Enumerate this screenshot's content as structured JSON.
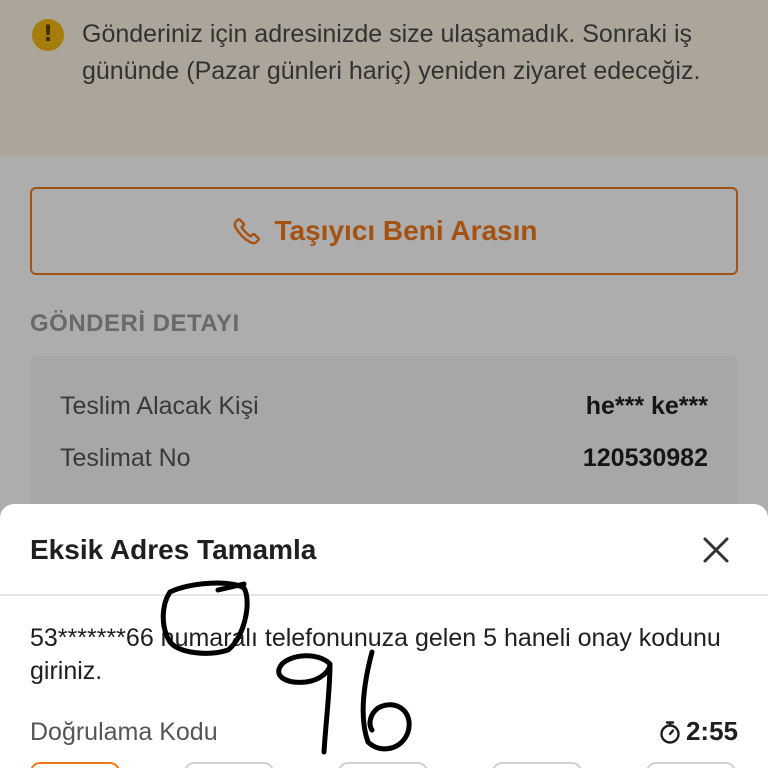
{
  "banner": {
    "icon": "warning-exclamation-icon",
    "icon_glyph": "!",
    "message": "Gönderiniz için adresinizde size ulaşamadık. Sonraki iş gününde (Pazar günleri hariç) yeniden ziyaret edeceğiz."
  },
  "call_button": {
    "icon": "phone-icon",
    "label": "Taşıyıcı Beni Arasın"
  },
  "details": {
    "section_title": "GÖNDERİ DETAYI",
    "rows": [
      {
        "label": "Teslim Alacak Kişi",
        "value": "he*** ke***"
      },
      {
        "label": "Teslimat No",
        "value": "120530982"
      }
    ]
  },
  "sheet": {
    "title": "Eksik Adres Tamamla",
    "close_icon": "close-icon",
    "message": "53*******66 numaralı telefonunuza gelen 5 haneli onay kodunu giriniz.",
    "code_label": "Doğrulama Kodu",
    "timer_icon": "stopwatch-icon",
    "timer": "2:55",
    "otp_count": 5
  },
  "colors": {
    "accent": "#f27a1a",
    "warning": "#f2b80f",
    "banner_bg": "#fdf4e3"
  }
}
